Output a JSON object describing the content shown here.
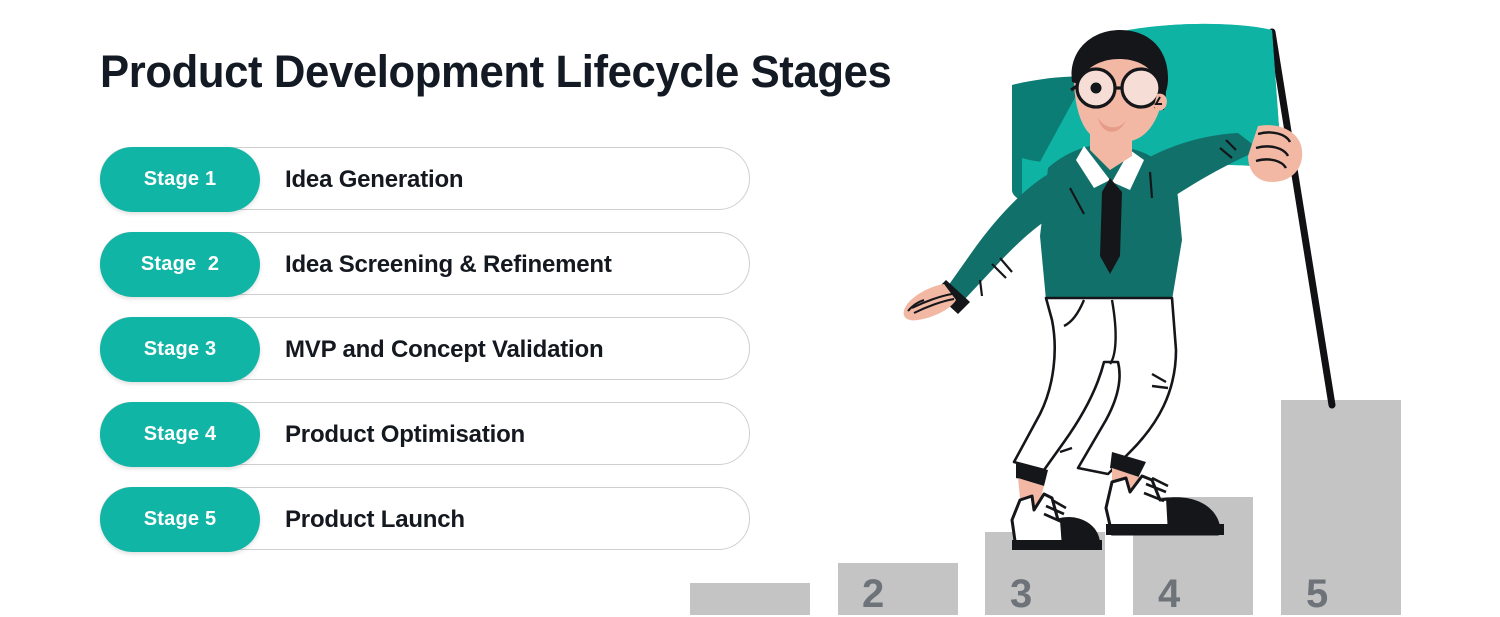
{
  "page": {
    "title": "Product Development Lifecycle Stages",
    "background_color": "#ffffff"
  },
  "theme": {
    "accent_teal": "#10b5a5",
    "shirt_teal": "#12706b",
    "flag_teal": "#0fb3a4",
    "flag_shadow_teal": "#0b7d74",
    "title_color": "#131a24",
    "label_color": "#14181f",
    "pill_border": "#cfcfcf",
    "bar_gray": "#c4c4c4",
    "bar_number_gray": "#6e7379",
    "skin": "#f2b8a4",
    "hair_black": "#15161a"
  },
  "stages": [
    {
      "badge": "Stage 1",
      "label": "Idea Generation"
    },
    {
      "badge": "Stage  2",
      "label": "Idea Screening & Refinement"
    },
    {
      "badge": "Stage 3",
      "label": "MVP and Concept Validation"
    },
    {
      "badge": "Stage 4",
      "label": "Product Optimisation"
    },
    {
      "badge": "Stage 5",
      "label": "Product Launch"
    }
  ],
  "chart_data": {
    "type": "bar",
    "title": "Product Development Lifecycle Stages",
    "xlabel": "",
    "ylabel": "",
    "grid": false,
    "legend": null,
    "categories": [
      "1",
      "2",
      "3",
      "4",
      "5"
    ],
    "values": [
      1,
      2,
      3,
      4,
      5
    ],
    "tick_labels": [
      "",
      "2",
      "3",
      "4",
      "5"
    ],
    "annotations": [
      "Stage 1 — Idea Generation",
      "Stage  2 — Idea Screening & Refinement",
      "Stage 3 — MVP and Concept Validation",
      "Stage 4 — Product Optimisation",
      "Stage 5 — Product Launch"
    ]
  },
  "illustration": {
    "name": "businessman-climbing-steps-with-flag",
    "flag": "teal-flag",
    "pole": "flag-pole",
    "character": "person-with-glasses",
    "steps": [
      {
        "number": "",
        "name": "step-1"
      },
      {
        "number": "2",
        "name": "step-2"
      },
      {
        "number": "3",
        "name": "step-3"
      },
      {
        "number": "4",
        "name": "step-4"
      },
      {
        "number": "5",
        "name": "step-5"
      }
    ]
  }
}
